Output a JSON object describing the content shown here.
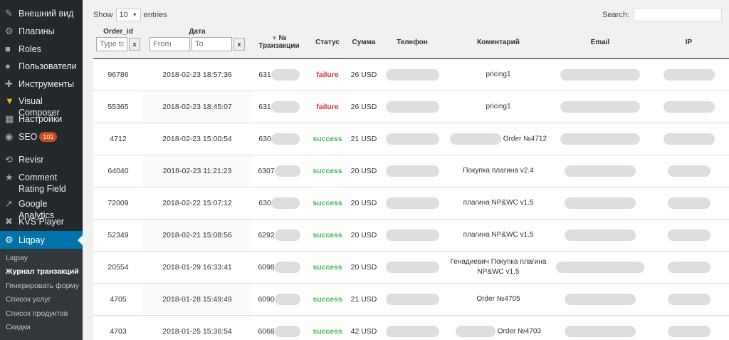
{
  "sidebar": {
    "items": [
      {
        "label": "Внешний вид",
        "icon": "paintbrush-icon"
      },
      {
        "label": "Плагины",
        "icon": "plugin-icon"
      },
      {
        "label": "Roles",
        "icon": "users-icon"
      },
      {
        "label": "Пользователи",
        "icon": "user-icon"
      },
      {
        "label": "Инструменты",
        "icon": "wrench-icon"
      },
      {
        "label": "Visual Composer",
        "icon": "composer-icon"
      },
      {
        "label": "Настройки",
        "icon": "settings-icon"
      },
      {
        "label": "SEO",
        "icon": "seo-icon",
        "badge": "101"
      },
      {
        "label": "Revisr",
        "icon": "revisr-icon"
      },
      {
        "label": "Comment Rating Field",
        "icon": "star-icon"
      },
      {
        "label": "Google Analytics",
        "icon": "chart-icon"
      },
      {
        "label": "KVS Player",
        "icon": "player-icon"
      },
      {
        "label": "Liqpay",
        "icon": "gear-icon"
      }
    ],
    "submenu": [
      "Liqpay",
      "Журнал транзакций",
      "Генерировать форму",
      "Список услуг",
      "Список продуктов",
      "Скидки"
    ]
  },
  "controls": {
    "show_label": "Show",
    "show_value": "10",
    "entries_label": "entries",
    "search_label": "Search:"
  },
  "table": {
    "headers": {
      "order_id": "Order_id",
      "date": "Дата",
      "transaction": "№ Транзакции",
      "status": "Статус",
      "sum": "Сумма",
      "phone": "Телефон",
      "comment": "Коментарий",
      "email": "Email",
      "ip": "IP"
    },
    "filters": {
      "order_placeholder": "Type to",
      "from_placeholder": "From",
      "to_placeholder": "To",
      "clear": "x"
    },
    "rows": [
      {
        "order": "96786",
        "date": "2018-02-23 18:57:36",
        "txn": "631",
        "status": "failure",
        "sum": "26 USD",
        "comment": "pricing1"
      },
      {
        "order": "55365",
        "date": "2018-02-23 18:45:07",
        "txn": "631",
        "status": "failure",
        "sum": "26 USD",
        "comment": "pricing1"
      },
      {
        "order": "4712",
        "date": "2018-02-23 15:00:54",
        "txn": "630",
        "status": "success",
        "sum": "21 USD",
        "comment": "Order №4712"
      },
      {
        "order": "64040",
        "date": "2018-02-23 11:21:23",
        "txn": "6307",
        "status": "success",
        "sum": "20 USD",
        "comment": "Покупка плагина v2.4"
      },
      {
        "order": "72009",
        "date": "2018-02-22 15:07:12",
        "txn": "630",
        "status": "success",
        "sum": "20 USD",
        "comment": "плагина NP&WC v1.5"
      },
      {
        "order": "52349",
        "date": "2018-02-21 15:08:56",
        "txn": "6292",
        "status": "success",
        "sum": "20 USD",
        "comment": "плагина NP&WC v1.5"
      },
      {
        "order": "20554",
        "date": "2018-01-29 16:33:41",
        "txn": "6098",
        "status": "success",
        "sum": "20 USD",
        "comment": "Генадиевич Покупка плагина NP&WC v1.5"
      },
      {
        "order": "4705",
        "date": "2018-01-28 15:49:49",
        "txn": "6090",
        "status": "success",
        "sum": "21 USD",
        "comment": "Order №4705"
      },
      {
        "order": "4703",
        "date": "2018-01-25 15:36:54",
        "txn": "6068",
        "status": "success",
        "sum": "42 USD",
        "comment": "Order №4703"
      }
    ]
  }
}
